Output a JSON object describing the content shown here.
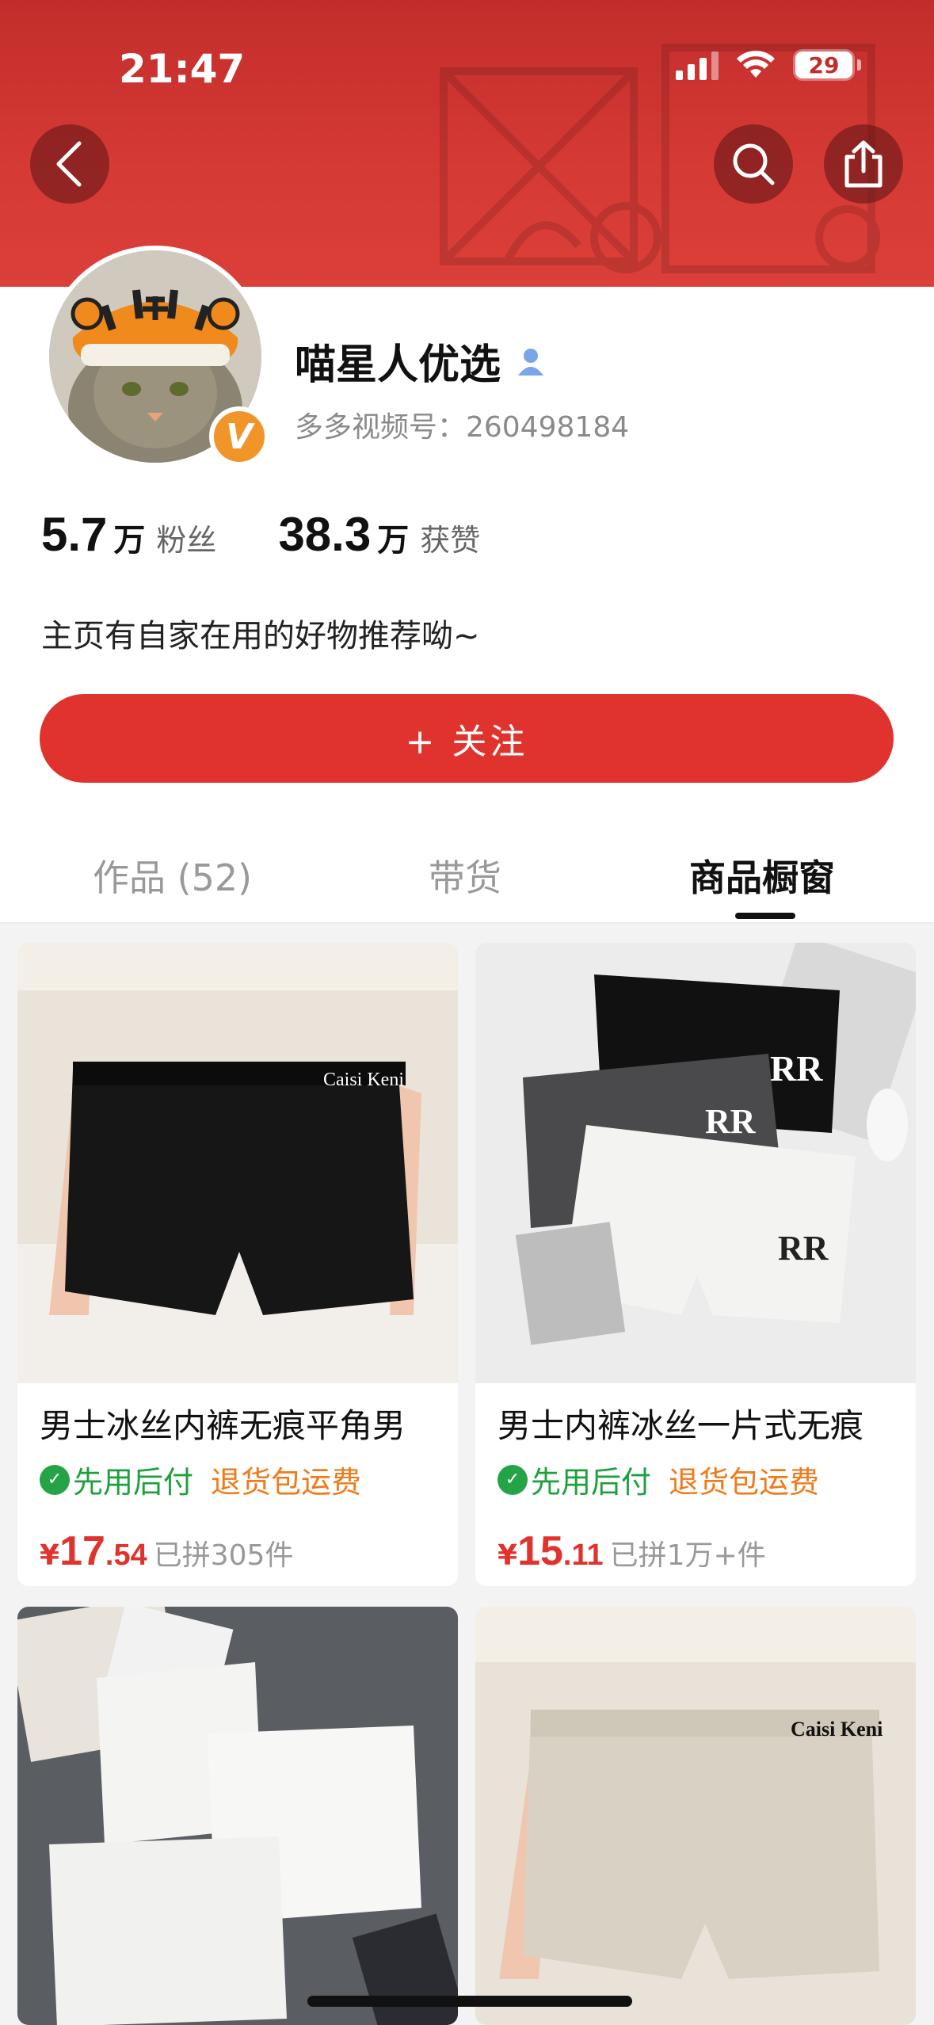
{
  "status_bar": {
    "time": "21:47",
    "battery": "29"
  },
  "profile": {
    "name": "喵星人优选",
    "video_id": "多多视频号：260498184",
    "badge": "V",
    "followers_num": "5.7",
    "followers_unit": "万",
    "followers_label": "粉丝",
    "likes_num": "38.3",
    "likes_unit": "万",
    "likes_label": "获赞",
    "bio": "主页有自家在用的好物推荐呦~"
  },
  "follow_button": "+ 关注",
  "tabs": [
    {
      "label": "作品 (52)"
    },
    {
      "label": "带货"
    },
    {
      "label": "商品橱窗"
    }
  ],
  "products": [
    {
      "title": "男士冰丝内裤无痕平角男",
      "tag1": "先用后付",
      "tag2": "退货包运费",
      "yen": "¥",
      "price_int": "17",
      "price_dec": ".54",
      "sold": "已拼305件",
      "brand_text": "Caisi Keni"
    },
    {
      "title": "男士内裤冰丝一片式无痕",
      "tag1": "先用后付",
      "tag2": "退货包运费",
      "yen": "¥",
      "price_int": "15",
      "price_dec": ".11",
      "sold": "已拼1万+件",
      "brand_text": "RR"
    },
    {
      "brand_text": ""
    },
    {
      "brand_text": "Caisi Keni"
    }
  ],
  "colors": {
    "brand_red": "#e1332d",
    "banner_red": "#d63a35",
    "green": "#1ea03d",
    "orange": "#f07a1a",
    "badge_orange": "#f29528"
  }
}
